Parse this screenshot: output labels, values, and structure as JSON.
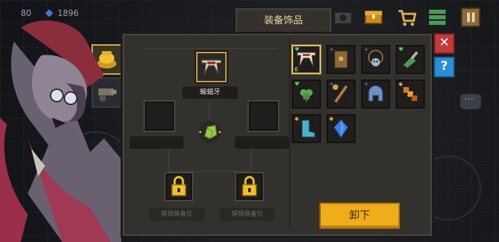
{
  "top_bar": {
    "coins": "80",
    "gems": "1896"
  },
  "panel": {
    "tab_title": "装备饰品",
    "equipped_name": "蝙蝠牙",
    "locked_slot_left_label": "解锁装备位",
    "locked_slot_right_label": "解锁装备位",
    "unequip_label": "卸下"
  },
  "inventory": {
    "items": [
      {
        "icon": "bat-fang-icon",
        "badge": "heart",
        "badge_color": "#49d06b",
        "equipped": true
      },
      {
        "icon": "scroll-icon",
        "badge": "plus",
        "badge_color": "#4aa6ff"
      },
      {
        "icon": "skull-necklace-icon",
        "badge": "plus",
        "badge_color": "#4aa6ff"
      },
      {
        "icon": "green-bottle-icon",
        "badge": "heart",
        "badge_color": "#49d06b"
      },
      {
        "icon": "clover-icon",
        "badge": "heart",
        "badge_color": "#49d06b"
      },
      {
        "icon": "wand-icon",
        "badge": "plus",
        "badge_color": "#4aa6ff"
      },
      {
        "icon": "blue-helmet-icon",
        "badge": "plus",
        "badge_color": "#4aa6ff"
      },
      {
        "icon": "orange-chain-icon",
        "badge": "shield",
        "badge_color": "#e2a23a"
      },
      {
        "icon": "cyan-boot-icon",
        "badge": "shield",
        "badge_color": "#e2a23a"
      },
      {
        "icon": "blue-gem-icon",
        "badge": "shield",
        "badge_color": "#e2a23a"
      }
    ],
    "equipped_marker": "E"
  },
  "colors": {
    "accent": "#f0ad1b",
    "selected_border": "#e2c066",
    "panel_bg": "#33312e"
  }
}
